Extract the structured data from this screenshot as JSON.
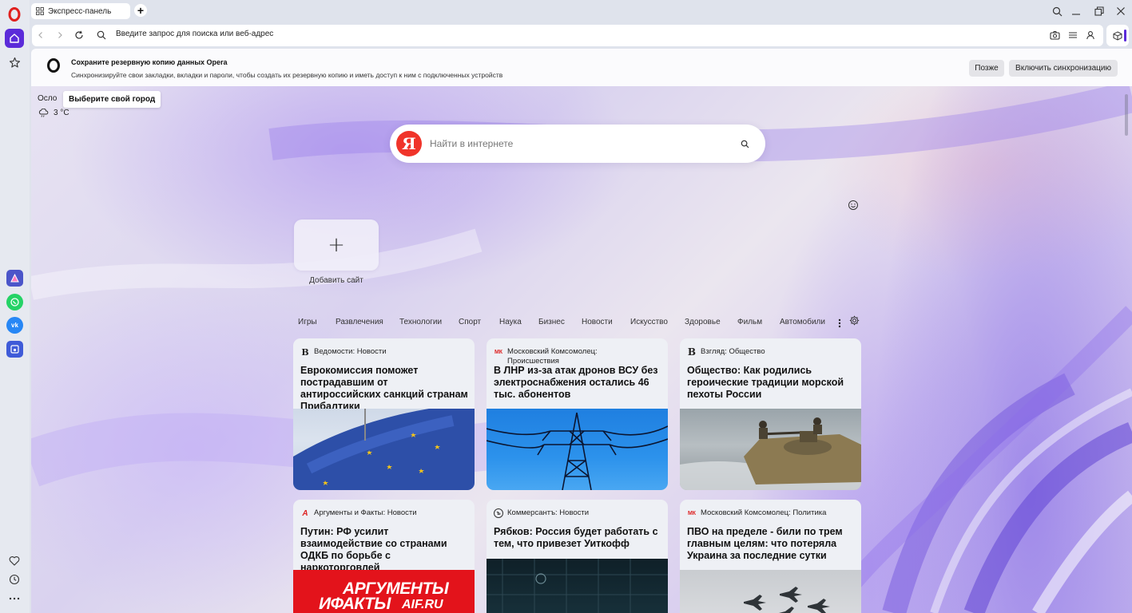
{
  "tab": {
    "title": "Экспресс-панель",
    "new_tab": "+"
  },
  "addressbar": {
    "placeholder": "Введите запрос для поиска или веб-адрес"
  },
  "sync_banner": {
    "title": "Сохраните резервную копию данных Opera",
    "description": "Синхронизируйте свои закладки, вкладки и пароли, чтобы создать их резервную копию и иметь доступ к ним с подключенных устройств",
    "later_label": "Позже",
    "enable_label": "Включить синхронизацию"
  },
  "weather": {
    "city": "Осло",
    "tooltip": "Выберите свой город",
    "temperature": "3 °C",
    "icon": "cloud-rain-icon"
  },
  "search": {
    "engine_logo": "Я",
    "placeholder": "Найти в интернете"
  },
  "speed_dial": {
    "plus": "+",
    "add_label": "Добавить сайт"
  },
  "categories": [
    "Игры",
    "Развлечения",
    "Технологии",
    "Спорт",
    "Наука",
    "Бизнес",
    "Новости",
    "Искусство",
    "Здоровье",
    "Фильм",
    "Автомобили"
  ],
  "news": [
    {
      "source": "Ведомости: Новости",
      "source_icon": "В",
      "title": "Еврокомиссия поможет пострадавшим от антироссийских санкций странам Прибалтики"
    },
    {
      "source": "Московский Комсомолец: Происшествия",
      "source_icon": "МК",
      "title": "В ЛНР из-за атак дронов ВСУ без электроснабжения остались 46 тыс. абонентов"
    },
    {
      "source": "Взгляд: Общество",
      "source_icon": "В",
      "title": "Общество: Как родились героические традиции морской пехоты России"
    },
    {
      "source": "Аргументы и Факты: Новости",
      "source_icon": "АиФ",
      "title": "Путин: РФ усилит взаимодействие со странами ОДКБ по борьбе с наркоторговлей",
      "image_text_1": "АРГУМЕНТЫ",
      "image_text_2": "ИФАКТЫ",
      "image_text_3": "AIF.RU"
    },
    {
      "source": "Коммерсантъ: Новости",
      "source_icon": "Ъ",
      "title": "Рябков: Россия будет работать с тем, что привезет Уиткофф"
    },
    {
      "source": "Московский Комсомолец: Политика",
      "source_icon": "МК",
      "title": "ПВО на пределе - били по трем главным целям: что потеряла Украина за последние сутки"
    }
  ],
  "colors": {
    "accent": "#5b2bd9",
    "opera_red": "#e0201e",
    "yandex_red": "#f0342a"
  }
}
